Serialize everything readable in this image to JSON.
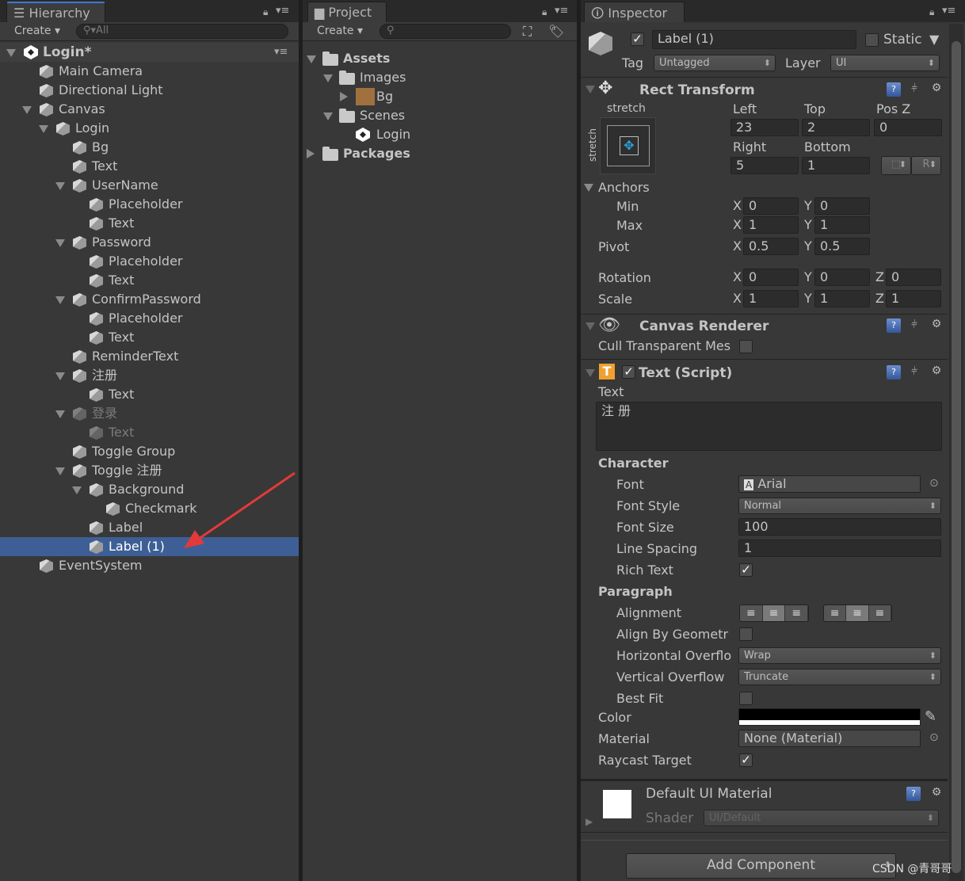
{
  "hierarchy": {
    "tab": "Hierarchy",
    "create": "Create",
    "search_placeholder": "All",
    "items": [
      {
        "label": "Login*",
        "level": 0,
        "expanded": true,
        "scene": true
      },
      {
        "label": "Main Camera",
        "level": 1
      },
      {
        "label": "Directional Light",
        "level": 1
      },
      {
        "label": "Canvas",
        "level": 1,
        "expanded": true
      },
      {
        "label": "Login",
        "level": 2,
        "expanded": true
      },
      {
        "label": "Bg",
        "level": 3
      },
      {
        "label": "Text",
        "level": 3
      },
      {
        "label": "UserName",
        "level": 3,
        "expanded": true
      },
      {
        "label": "Placeholder",
        "level": 4
      },
      {
        "label": "Text",
        "level": 4
      },
      {
        "label": "Password",
        "level": 3,
        "expanded": true
      },
      {
        "label": "Placeholder",
        "level": 4
      },
      {
        "label": "Text",
        "level": 4
      },
      {
        "label": "ConfirmPassword",
        "level": 3,
        "expanded": true
      },
      {
        "label": "Placeholder",
        "level": 4
      },
      {
        "label": "Text",
        "level": 4
      },
      {
        "label": "ReminderText",
        "level": 3
      },
      {
        "label": "注册",
        "level": 3,
        "expanded": true
      },
      {
        "label": "Text",
        "level": 4
      },
      {
        "label": "登录",
        "level": 3,
        "expanded": true,
        "disabled": true
      },
      {
        "label": "Text",
        "level": 4,
        "disabled": true
      },
      {
        "label": "Toggle Group",
        "level": 3
      },
      {
        "label": "Toggle 注册",
        "level": 3,
        "expanded": true
      },
      {
        "label": "Background",
        "level": 4,
        "expanded": true
      },
      {
        "label": "Checkmark",
        "level": 5
      },
      {
        "label": "Label",
        "level": 4
      },
      {
        "label": "Label (1)",
        "level": 4,
        "selected": true
      },
      {
        "label": "EventSystem",
        "level": 1
      }
    ]
  },
  "project": {
    "tab": "Project",
    "create": "Create",
    "items": [
      {
        "label": "Assets",
        "level": 0,
        "type": "folder",
        "expanded": true
      },
      {
        "label": "Images",
        "level": 1,
        "type": "folder",
        "expanded": true
      },
      {
        "label": "Bg",
        "level": 2,
        "type": "image",
        "collapsed": true
      },
      {
        "label": "Scenes",
        "level": 1,
        "type": "folder",
        "expanded": true
      },
      {
        "label": "Login",
        "level": 2,
        "type": "scene"
      },
      {
        "label": "Packages",
        "level": 0,
        "type": "folder",
        "collapsed": true
      }
    ]
  },
  "inspector": {
    "tab": "Inspector",
    "name": "Label (1)",
    "active": true,
    "static_label": "Static",
    "static": false,
    "tag_label": "Tag",
    "tag": "Untagged",
    "layer_label": "Layer",
    "layer": "UI",
    "rect": {
      "title": "Rect Transform",
      "anchor_h": "stretch",
      "anchor_v": "stretch",
      "left_label": "Left",
      "top_label": "Top",
      "posz_label": "Pos Z",
      "left": "23",
      "top": "2",
      "posz": "0",
      "right_label": "Right",
      "bottom_label": "Bottom",
      "right": "5",
      "bottom": "1",
      "r_button": "R",
      "anchors_label": "Anchors",
      "min_label": "Min",
      "max_label": "Max",
      "pivot_label": "Pivot",
      "min_x": "0",
      "min_y": "0",
      "max_x": "1",
      "max_y": "1",
      "pivot_x": "0.5",
      "pivot_y": "0.5",
      "rotation_label": "Rotation",
      "scale_label": "Scale",
      "rot_x": "0",
      "rot_y": "0",
      "rot_z": "0",
      "scale_x": "1",
      "scale_y": "1",
      "scale_z": "1",
      "x": "X",
      "y": "Y",
      "z": "Z"
    },
    "canvas_renderer": {
      "title": "Canvas Renderer",
      "cull_label": "Cull Transparent Mes",
      "cull": false
    },
    "text": {
      "title": "Text (Script)",
      "text_label": "Text",
      "text_value": "注 册",
      "character": "Character",
      "font_label": "Font",
      "font": "Arial",
      "font_style_label": "Font Style",
      "font_style": "Normal",
      "font_size_label": "Font Size",
      "font_size": "100",
      "line_spacing_label": "Line Spacing",
      "line_spacing": "1",
      "rich_text_label": "Rich Text",
      "rich_text": true,
      "paragraph": "Paragraph",
      "alignment_label": "Alignment",
      "align_geom_label": "Align By Geometr",
      "align_geom": false,
      "h_overflow_label": "Horizontal Overflo",
      "h_overflow": "Wrap",
      "v_overflow_label": "Vertical Overflow",
      "v_overflow": "Truncate",
      "best_fit_label": "Best Fit",
      "best_fit": false,
      "color_label": "Color",
      "color": "#000000",
      "material_label": "Material",
      "material": "None (Material)",
      "raycast_label": "Raycast Target",
      "raycast": true
    },
    "material": {
      "title": "Default UI Material",
      "shader_label": "Shader",
      "shader": "UI/Default"
    },
    "add_component": "Add Component"
  },
  "watermark": "CSDN @青哥哥",
  "colors": {
    "selection": "#3e5f96",
    "panel": "#383838",
    "annotation_arrow": "#e23a3a"
  }
}
